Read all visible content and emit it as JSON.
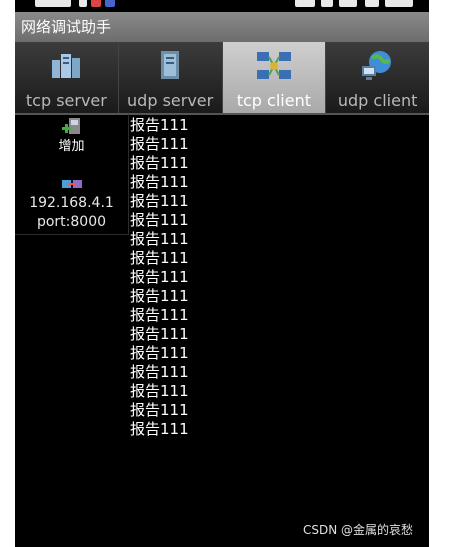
{
  "app": {
    "title": "网络调试助手"
  },
  "tabs": [
    {
      "label": "tcp  server",
      "icon": "server-stack-icon",
      "active": false
    },
    {
      "label": "udp  server",
      "icon": "server-tower-icon",
      "active": false
    },
    {
      "label": "tcp  client",
      "icon": "network-client-icon",
      "active": true
    },
    {
      "label": "udp  client",
      "icon": "globe-network-icon",
      "active": false
    }
  ],
  "sidebar": {
    "add_label": "增加",
    "connection": {
      "ip": "192.168.4.1",
      "port": "port:8000"
    }
  },
  "log": {
    "lines": [
      "报告111",
      "报告111",
      "报告111",
      "报告111",
      "报告111",
      "报告111",
      "报告111",
      "报告111",
      "报告111",
      "报告111",
      "报告111",
      "报告111",
      "报告111",
      "报告111",
      "报告111",
      "报告111",
      "报告111"
    ]
  },
  "watermark": "CSDN @金属的哀愁",
  "colors": {
    "background": "#000000",
    "title_bar": "#7a7a7a",
    "active_tab": "#bdbdbd"
  }
}
